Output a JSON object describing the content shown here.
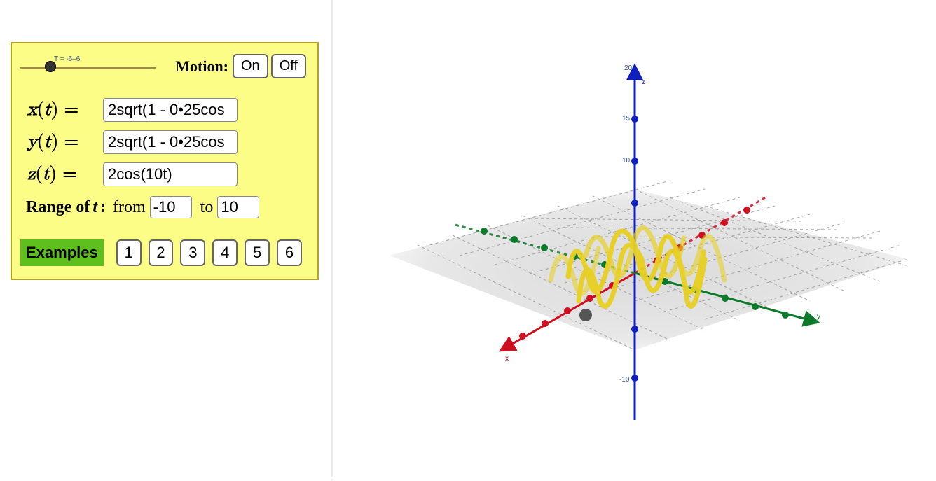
{
  "slider": {
    "label": "T = -6–6"
  },
  "motion": {
    "label": "Motion:",
    "on": "On",
    "off": "Off"
  },
  "equations": {
    "x": {
      "label": "x(t) =",
      "value": "2sqrt(1 - 0•25cos"
    },
    "y": {
      "label": "y(t) =",
      "value": "2sqrt(1 - 0•25cos"
    },
    "z": {
      "label": "z(t) =",
      "value": "2cos(10t)"
    }
  },
  "range": {
    "label": "Range of",
    "var": "t",
    "from_word": "from",
    "from": "-10",
    "to_word": "to",
    "to": "10"
  },
  "examples": {
    "label": "Examples",
    "items": [
      "1",
      "2",
      "3",
      "4",
      "5",
      "6"
    ]
  },
  "axes3d": {
    "x": {
      "name": "x",
      "color": "#d01020"
    },
    "y": {
      "name": "y",
      "color": "#0b7a2a"
    },
    "z": {
      "name": "z",
      "color": "#1020c0"
    },
    "z_ticks": [
      "20",
      "15",
      "10",
      "-10"
    ]
  },
  "chart_data": {
    "type": "parametric-3d",
    "title": "",
    "functions": {
      "x": "2*sqrt(1 - 0.25*cos(...))",
      "y": "2*sqrt(1 - 0.25*cos(...))",
      "z": "2*cos(10*t)"
    },
    "t_range": [
      -10,
      10
    ],
    "axes": {
      "x": {
        "label": "x",
        "range": [
          -6,
          6
        ]
      },
      "y": {
        "label": "y",
        "range": [
          -6,
          6
        ]
      },
      "z": {
        "label": "z",
        "range": [
          -10,
          20
        ],
        "ticks": [
          -10,
          10,
          15,
          20
        ]
      }
    },
    "slider_T": -6
  }
}
